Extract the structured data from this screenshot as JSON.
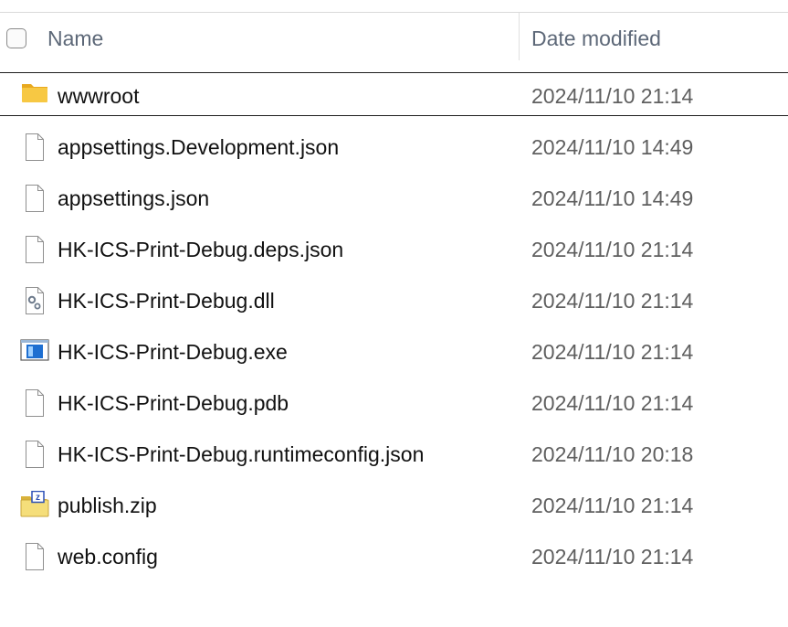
{
  "header": {
    "name_label": "Name",
    "date_label": "Date modified",
    "sort_icon": "chevron-up-icon"
  },
  "files": [
    {
      "name": "wwwroot",
      "date": "2024/11/10 21:14",
      "icon": "folder-icon"
    },
    {
      "name": "appsettings.Development.json",
      "date": "2024/11/10 14:49",
      "icon": "file-icon"
    },
    {
      "name": "appsettings.json",
      "date": "2024/11/10 14:49",
      "icon": "file-icon"
    },
    {
      "name": "HK-ICS-Print-Debug.deps.json",
      "date": "2024/11/10 21:14",
      "icon": "file-icon"
    },
    {
      "name": "HK-ICS-Print-Debug.dll",
      "date": "2024/11/10 21:14",
      "icon": "dll-icon"
    },
    {
      "name": "HK-ICS-Print-Debug.exe",
      "date": "2024/11/10 21:14",
      "icon": "exe-icon"
    },
    {
      "name": "HK-ICS-Print-Debug.pdb",
      "date": "2024/11/10 21:14",
      "icon": "file-icon"
    },
    {
      "name": "HK-ICS-Print-Debug.runtimeconfig.json",
      "date": "2024/11/10 20:18",
      "icon": "file-icon"
    },
    {
      "name": "publish.zip",
      "date": "2024/11/10 21:14",
      "icon": "zip-icon"
    },
    {
      "name": "web.config",
      "date": "2024/11/10 21:14",
      "icon": "file-icon"
    }
  ],
  "colors": {
    "header_text": "#5d6878",
    "name_text": "#111111",
    "date_text": "#5f5f5f",
    "folder_yellow": "#f7c843",
    "exe_blue": "#1e6fd1"
  }
}
